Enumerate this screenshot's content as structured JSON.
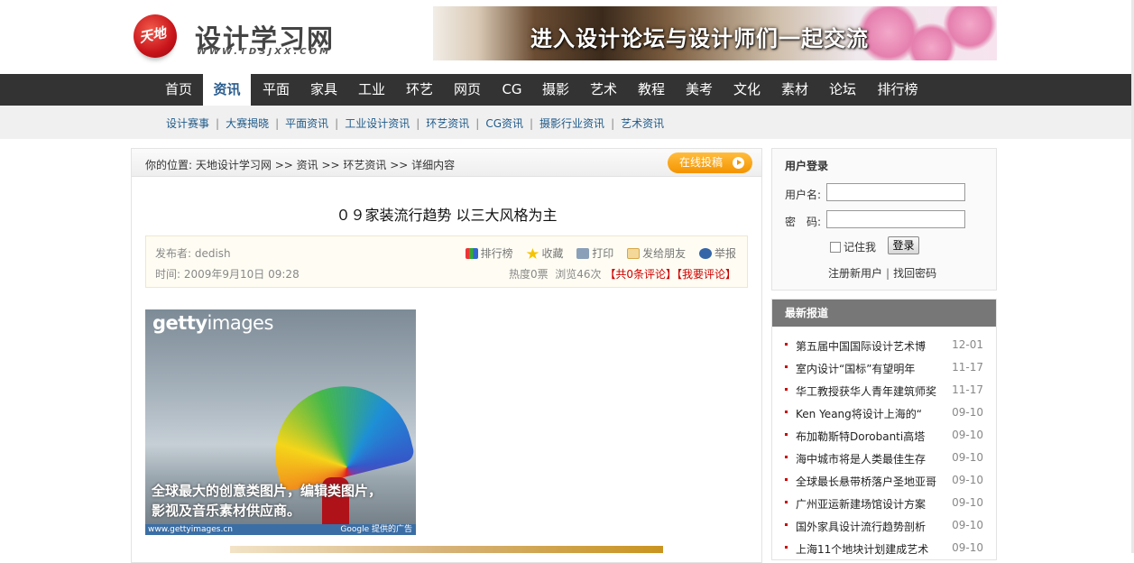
{
  "header": {
    "logo_mark": "天地",
    "site_title": "设计学习网",
    "site_url": "WWW.TDSJXX.COM",
    "banner_text": "进入设计论坛与设计师们一起交流"
  },
  "nav": {
    "items": [
      {
        "label": "首页"
      },
      {
        "label": "资讯"
      },
      {
        "label": "平面"
      },
      {
        "label": "家具"
      },
      {
        "label": "工业"
      },
      {
        "label": "环艺"
      },
      {
        "label": "网页"
      },
      {
        "label": "CG"
      },
      {
        "label": "摄影"
      },
      {
        "label": "艺术"
      },
      {
        "label": "教程"
      },
      {
        "label": "美考"
      },
      {
        "label": "文化"
      },
      {
        "label": "素材"
      },
      {
        "label": "论坛"
      },
      {
        "label": "排行榜"
      }
    ],
    "active": "资讯"
  },
  "subnav": {
    "items": [
      "设计赛事",
      "大赛揭晓",
      "平面资讯",
      "工业设计资讯",
      "环艺资讯",
      "CG资讯",
      "摄影行业资讯",
      "艺术资讯"
    ]
  },
  "breadcrumb": {
    "prefix": "你的位置:",
    "items": [
      "天地设计学习网",
      ">> 资讯",
      ">> 环艺资讯",
      ">> 详细内容"
    ],
    "submit_label": "在线投稿"
  },
  "article": {
    "title": "０９家装流行趋势 以三大风格为主",
    "author": "发布者: dedish",
    "time": "时间: 2009年9月10日 09:28",
    "tools": [
      "排行榜",
      "收藏",
      "打印",
      "发给朋友",
      "举报"
    ],
    "hot": "热度0票",
    "views": "浏览46次",
    "comments": "【共0条评论】",
    "my_comment": "【我要评论】"
  },
  "ad": {
    "logo_bold": "getty",
    "logo_light": "images",
    "text_line1": "全球最大的创意类图片，编辑类图片，",
    "text_line2": "影视及音乐素材供应商。",
    "url": "www.gettyimages.cn",
    "provider": "Google 提供的广告"
  },
  "login": {
    "title": "用户登录",
    "username_label": "用户名:",
    "password_label": "密　码:",
    "remember_label": "记住我",
    "login_button": "登录",
    "register_link": "注册新用户",
    "forgot_link": "找回密码"
  },
  "news": {
    "title": "最新报道",
    "items": [
      {
        "title": "第五届中国国际设计艺术博",
        "date": "12-01"
      },
      {
        "title": "室内设计“国标”有望明年",
        "date": "11-17"
      },
      {
        "title": "华工教授获华人青年建筑师奖",
        "date": "11-17"
      },
      {
        "title": "Ken Yeang将设计上海的“",
        "date": "09-10"
      },
      {
        "title": "布加勒斯特Dorobanti高塔",
        "date": "09-10"
      },
      {
        "title": "海中城市将是人类最佳生存",
        "date": "09-10"
      },
      {
        "title": "全球最长悬带桥落户圣地亚哥",
        "date": "09-10"
      },
      {
        "title": "广州亚运新建场馆设计方案",
        "date": "09-10"
      },
      {
        "title": "国外家具设计流行趋势剖析",
        "date": "09-10"
      },
      {
        "title": "上海11个地块计划建成艺术",
        "date": "09-10"
      }
    ]
  },
  "colors": {
    "nav_bg": "#333333",
    "accent_orange": "#f49400",
    "link_blue": "#1e5a8a",
    "news_header": "#777777",
    "comment_red": "#cc0000"
  }
}
